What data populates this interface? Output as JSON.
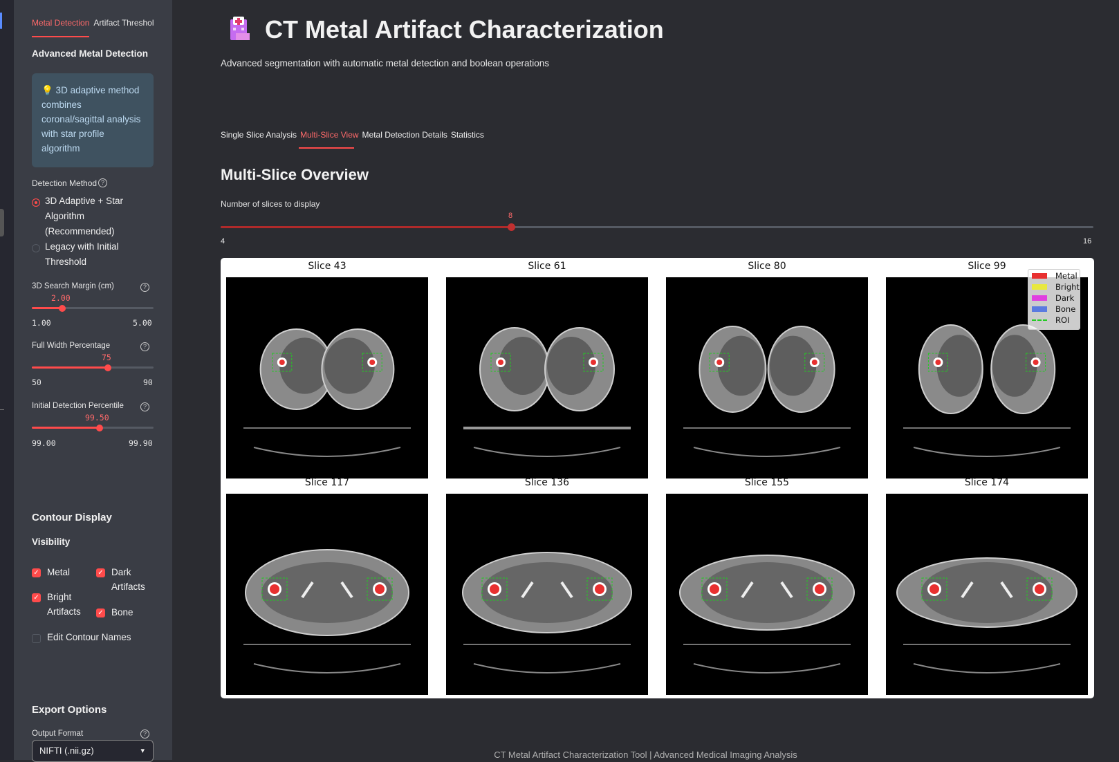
{
  "sidebar": {
    "tabs": [
      "Metal Detection",
      "Artifact Thresholds"
    ],
    "section_title": "Advanced Metal Detection",
    "info": "💡 3D adaptive method combines coronal/sagittal analysis with star profile algorithm",
    "detection_method": {
      "label": "Detection Method",
      "options": [
        "3D Adaptive + Star Algorithm (Recommended)",
        "Legacy with Initial Threshold"
      ],
      "selected": "3D Adaptive + Star Algorithm (Recommended)"
    },
    "sliders": [
      {
        "label": "3D Search Margin (cm)",
        "value": "2.00",
        "min": "1.00",
        "max": "5.00",
        "fraction": 0.25
      },
      {
        "label": "Full Width Percentage",
        "value": "75",
        "min": "50",
        "max": "90",
        "fraction": 0.625
      },
      {
        "label": "Initial Detection Percentile",
        "value": "99.50",
        "min": "99.00",
        "max": "99.90",
        "fraction": 0.556
      }
    ],
    "contour_display": {
      "title": "Contour Display",
      "visibility_label": "Visibility",
      "checks": {
        "metal": "Metal",
        "dark_artifacts": "Dark Artifacts",
        "bright_artifacts": "Bright Artifacts",
        "bone": "Bone"
      },
      "edit_names": "Edit Contour Names"
    },
    "export": {
      "title": "Export Options",
      "format_label": "Output Format",
      "format_value": "NIFTI (.nii.gz)"
    }
  },
  "main": {
    "title": "CT Metal Artifact Characterization",
    "subtitle": "Advanced segmentation with automatic metal detection and boolean operations",
    "tabs": [
      "Single Slice Analysis",
      "Multi-Slice View",
      "Metal Detection Details",
      "Statistics"
    ],
    "active_tab": "Multi-Slice View",
    "section": "Multi-Slice Overview",
    "slider": {
      "label": "Number of slices to display",
      "value": "8",
      "min": "4",
      "max": "16",
      "fraction": 0.333
    },
    "slices": [
      "Slice 43",
      "Slice 61",
      "Slice 80",
      "Slice 99",
      "Slice 117",
      "Slice 136",
      "Slice 155",
      "Slice 174"
    ],
    "legend": [
      {
        "label": "Metal",
        "color": "#e83030"
      },
      {
        "label": "Bright",
        "color": "#e8e840"
      },
      {
        "label": "Dark",
        "color": "#e040e0"
      },
      {
        "label": "Bone",
        "color": "#5a7ae0"
      },
      {
        "label": "ROI",
        "color": "#22cc22"
      }
    ],
    "footer": "CT Metal Artifact Characterization Tool | Advanced Medical Imaging Analysis"
  }
}
